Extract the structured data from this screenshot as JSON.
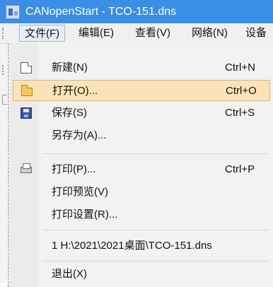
{
  "window": {
    "title": "CANopenStart - TCO-151.dns"
  },
  "menubar": {
    "items": [
      {
        "label": "文件(F)",
        "active": true
      },
      {
        "label": "编辑(E)"
      },
      {
        "label": "查看(V)"
      },
      {
        "label": "网络(N)"
      },
      {
        "label": "设备"
      }
    ]
  },
  "file_menu": {
    "items": [
      {
        "label": "新建(N)",
        "shortcut": "Ctrl+N",
        "icon": "new-file-icon"
      },
      {
        "label": "打开(O)...",
        "shortcut": "Ctrl+O",
        "icon": "open-folder-icon",
        "highlighted": true
      },
      {
        "label": "保存(S)",
        "shortcut": "Ctrl+S",
        "icon": "save-disk-icon"
      },
      {
        "label": "另存为(A)..."
      },
      {
        "label": "打印(P)...",
        "shortcut": "Ctrl+P",
        "icon": "printer-icon"
      },
      {
        "label": "打印预览(V)"
      },
      {
        "label": "打印设置(R)..."
      },
      {
        "label": "1 H:\\2021\\2021桌面\\TCO-151.dns"
      },
      {
        "label": "退出(X)"
      }
    ]
  },
  "colors": {
    "titlebar": "#3a8ee6",
    "highlight": "#fbe3b8",
    "highlight_border": "#e2b468"
  }
}
